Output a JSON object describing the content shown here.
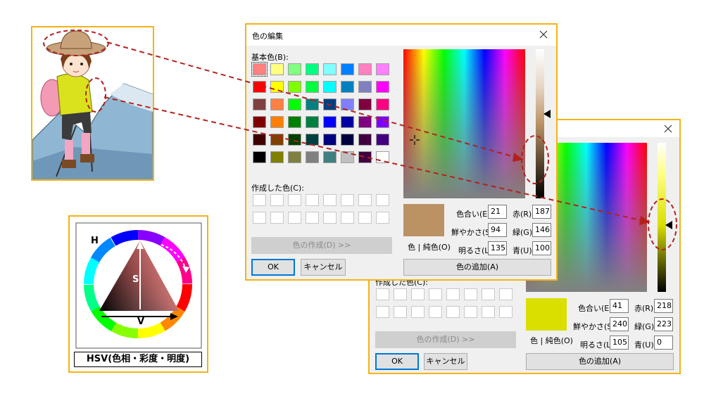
{
  "dialog_front": {
    "title": "色の編集",
    "basic_colors_label": "基本色(B):",
    "custom_colors_label": "作成した色(C):",
    "define_button": "色の作成(D) >>",
    "ok_button": "OK",
    "cancel_button": "キャンセル",
    "add_button": "色の追加(A)",
    "color_solid_label": "色 | 純色(O)",
    "hue_label": "色合い(E):",
    "sat_label": "鮮やかさ(S):",
    "lum_label": "明るさ(L):",
    "red_label": "赤(R):",
    "green_label": "緑(G):",
    "blue_label": "青(U):",
    "hue": "21",
    "sat": "94",
    "lum": "135",
    "red": "187",
    "green": "146",
    "blue": "100",
    "preview_color": "#bb9264",
    "basic_colors": [
      "#ff8080",
      "#ffff80",
      "#80ff80",
      "#00ff80",
      "#80ffff",
      "#0080ff",
      "#ff80c0",
      "#ff80ff",
      "#ff0000",
      "#ffff00",
      "#80ff00",
      "#00ff40",
      "#00ffff",
      "#0080c0",
      "#8080c0",
      "#ff00ff",
      "#804040",
      "#ff8040",
      "#00ff00",
      "#008080",
      "#004080",
      "#8080ff",
      "#800040",
      "#ff0080",
      "#800000",
      "#ff8000",
      "#008000",
      "#008040",
      "#0000ff",
      "#0000a0",
      "#800080",
      "#8000ff",
      "#400000",
      "#804000",
      "#004000",
      "#004040",
      "#000080",
      "#000040",
      "#400040",
      "#400080",
      "#000000",
      "#808000",
      "#808040",
      "#808080",
      "#408080",
      "#c0c0c0",
      "#400040",
      "#ffffff"
    ]
  },
  "dialog_back": {
    "custom_colors_label": "作成した色(C):",
    "define_button": "色の作成(D) >>",
    "ok_button": "OK",
    "cancel_button": "キャンセル",
    "add_button": "色の追加(A)",
    "color_solid_label": "色 | 純色(O)",
    "hue_label": "色合い(E):",
    "sat_label": "鮮やかさ(S):",
    "lum_label": "明るさ(L):",
    "red_label": "赤(R):",
    "green_label": "緑(G):",
    "blue_label": "青(U):",
    "hue": "41",
    "sat": "240",
    "lum": "105",
    "red": "218",
    "green": "223",
    "blue": "0",
    "preview_color": "#dadf00"
  },
  "hsv_diagram": {
    "h_label": "H",
    "s_label": "S",
    "v_label": "V",
    "caption": "HSV(色相・彩度・明度)"
  },
  "colors": {
    "frame": "#f2b417",
    "arrow": "#b3211e",
    "accent": "#0078d7"
  }
}
